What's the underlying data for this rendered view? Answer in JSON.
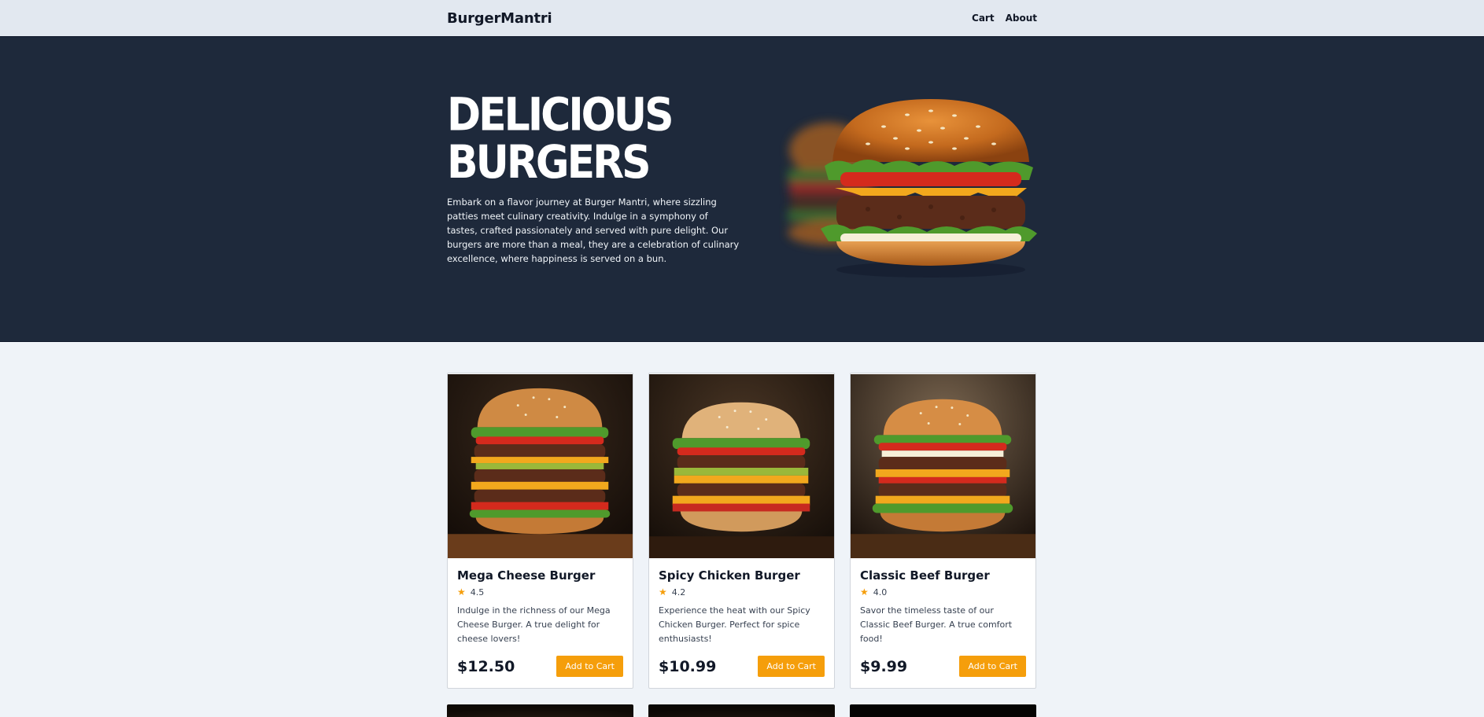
{
  "nav": {
    "brand": "BurgerMantri",
    "links": [
      {
        "label": "Cart"
      },
      {
        "label": "About"
      }
    ]
  },
  "hero": {
    "title_line1": "DELICIOUS",
    "title_line2": "BURGERS",
    "description": "Embark on a flavor journey at Burger Mantri, where sizzling patties meet culinary creativity. Indulge in a symphony of tastes, crafted passionately and served with pure delight. Our burgers are more than a meal, they are a celebration of culinary excellence, where happiness is served on a bun."
  },
  "products": [
    {
      "name": "Mega Cheese Burger",
      "rating": "4.5",
      "description": "Indulge in the richness of our Mega Cheese Burger. A true delight for cheese lovers!",
      "price": "$12.50",
      "button": "Add to Cart"
    },
    {
      "name": "Spicy Chicken Burger",
      "rating": "4.2",
      "description": "Experience the heat with our Spicy Chicken Burger. Perfect for spice enthusiasts!",
      "price": "$10.99",
      "button": "Add to Cart"
    },
    {
      "name": "Classic Beef Burger",
      "rating": "4.0",
      "description": "Savor the timeless taste of our Classic Beef Burger. A true comfort food!",
      "price": "$9.99",
      "button": "Add to Cart"
    }
  ],
  "icons": {
    "star": "star-icon"
  },
  "colors": {
    "accent": "#f59e0b",
    "hero_bg": "#1e293b",
    "nav_bg": "#e2e8f0",
    "page_bg": "#eff3f8"
  }
}
